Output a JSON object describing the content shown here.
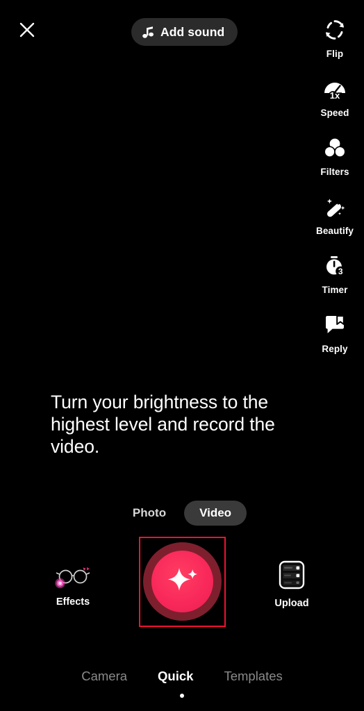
{
  "app": {
    "screen_name": "TikTok Camera",
    "background_color": "#000000",
    "accent_color": "#fe2c55"
  },
  "top_bar": {
    "close_icon": "close-icon",
    "add_sound": {
      "label": "Add sound",
      "icon": "music-note-icon",
      "background_color": "#2b2b2b"
    }
  },
  "tool_rail": {
    "items": [
      {
        "label": "Flip",
        "icon": "flip-camera-icon"
      },
      {
        "label": "Speed",
        "icon": "speedometer-icon",
        "badge": "1x"
      },
      {
        "label": "Filters",
        "icon": "filters-circles-icon"
      },
      {
        "label": "Beautify",
        "icon": "magic-wand-icon"
      },
      {
        "label": "Timer",
        "icon": "stopwatch-icon",
        "badge": "3"
      },
      {
        "label": "Reply",
        "icon": "reply-bubble-icon"
      }
    ]
  },
  "instruction": {
    "text": "Turn your brightness to the highest level and record the video."
  },
  "mode_toggle": {
    "options": [
      {
        "label": "Photo",
        "selected": false
      },
      {
        "label": "Video",
        "selected": true
      }
    ],
    "selected_background": "#3a3a3a"
  },
  "shutter_row": {
    "effects": {
      "label": "Effects",
      "icon": "effects-glasses-icon"
    },
    "record": {
      "icon": "sparkle-star-icon",
      "button_color": "#f8285a",
      "ring_color": "#7e1f2e",
      "highlight_color": "#f0122f",
      "highlighted": true
    },
    "upload": {
      "label": "Upload",
      "icon": "upload-gallery-icon"
    }
  },
  "bottom_nav": {
    "tabs": [
      {
        "label": "Camera",
        "active": false
      },
      {
        "label": "Quick",
        "active": true
      },
      {
        "label": "Templates",
        "active": false
      }
    ],
    "page_indicator_dot": true
  }
}
